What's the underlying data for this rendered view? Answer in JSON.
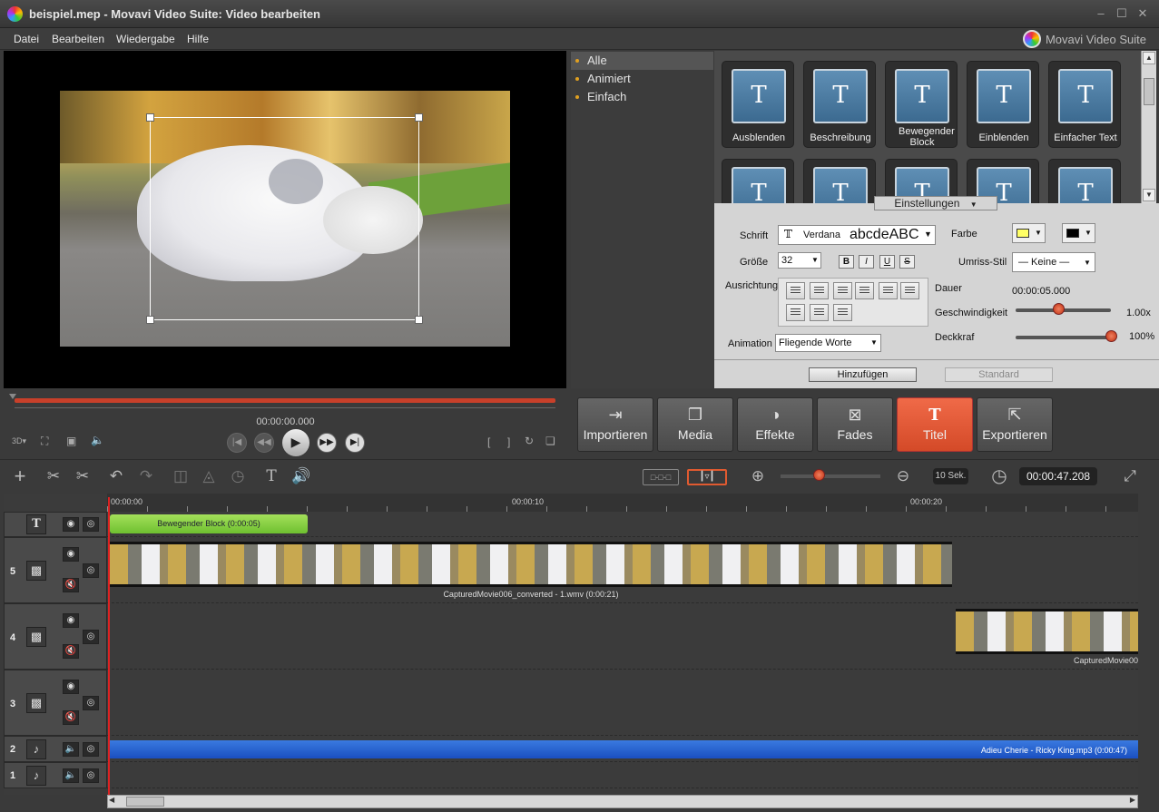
{
  "window": {
    "title": "beispiel.mep - Movavi Video Suite: Video bearbeiten",
    "brand": "Movavi Video Suite"
  },
  "menu": [
    "Datei",
    "Bearbeiten",
    "Wiedergabe",
    "Hilfe"
  ],
  "categories": [
    "Alle",
    "Animiert",
    "Einfach"
  ],
  "tiles": [
    "Ausblenden",
    "Beschreibung",
    "Bewegender Block",
    "Einblenden",
    "Einfacher Text"
  ],
  "tile_glyph": "T",
  "settings": {
    "tab": "Einstellungen",
    "schrift_label": "Schrift",
    "font": "Verdana",
    "font_sample": "abcdeABC",
    "farbe_label": "Farbe",
    "groesse_label": "Größe",
    "size": "32",
    "umriss_label": "Umriss-Stil",
    "umriss_value": "— Keine —",
    "ausrichtung_label": "Ausrichtung",
    "dauer_label": "Dauer",
    "dauer_value": "00:00:05.000",
    "geschw_label": "Geschwindigkeit",
    "geschw_value": "1.00x",
    "geschw_level": 0.45,
    "deckkraft_label": "Deckkraf",
    "deckkraft_value": "100%",
    "deckkraft_level": 1.0,
    "animation_label": "Animation",
    "animation_value": "Fliegende Worte",
    "add_button": "Hinzufügen",
    "default_button": "Standard",
    "color_fill": "#ffff66",
    "color_outline": "#000000"
  },
  "player": {
    "time": "00:00:00.000"
  },
  "tabs": [
    "Importieren",
    "Media",
    "Effekte",
    "Fades",
    "Titel",
    "Exportieren"
  ],
  "toolbar": {
    "zoom_label": "10 Sek.",
    "duration": "00:00:47.208"
  },
  "ruler": [
    "00:00:00",
    "00:00:10",
    "00:00:20"
  ],
  "tracks": {
    "n5": "5",
    "n4": "4",
    "n3": "3",
    "n2": "2",
    "n1": "1"
  },
  "clips": {
    "title": "Bewegender Block (0:00:05)",
    "video5": "CapturedMovie006_converted - 1.wmv (0:00:21)",
    "video4": "CapturedMovie00",
    "audio": "Adieu Cherie - Ricky King.mp3 (0:00:47)"
  }
}
